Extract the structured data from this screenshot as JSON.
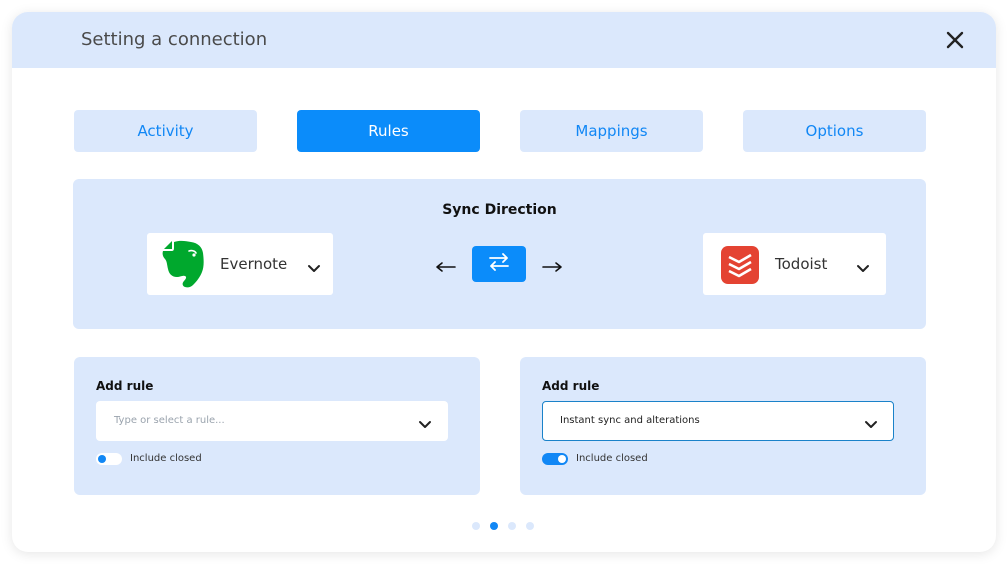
{
  "header": {
    "title": "Setting a connection"
  },
  "tabs": [
    {
      "label": "Activity",
      "active": false
    },
    {
      "label": "Rules",
      "active": true
    },
    {
      "label": "Mappings",
      "active": false
    },
    {
      "label": "Options",
      "active": false
    }
  ],
  "sync": {
    "title": "Sync Direction",
    "source_app": {
      "name": "Evernote",
      "icon": "evernote-logo"
    },
    "target_app": {
      "name": "Todoist",
      "icon": "todoist-logo"
    }
  },
  "rules": [
    {
      "label": "Add rule",
      "placeholder": "Type or select a rule...",
      "value": "",
      "toggle_label": "Include closed",
      "toggle_on": false
    },
    {
      "label": "Add rule",
      "placeholder": "",
      "value": "Instant sync and alterations",
      "toggle_label": "Include closed",
      "toggle_on": true
    }
  ],
  "pagination": {
    "total": 4,
    "current": 2
  },
  "colors": {
    "accent": "#0b8cfa",
    "panel": "#dbe8fc",
    "evernote": "#00a82d",
    "todoist": "#e44332"
  }
}
